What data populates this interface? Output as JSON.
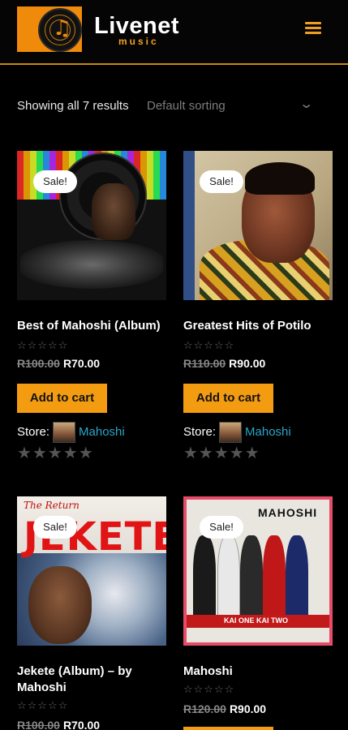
{
  "header": {
    "brand_name": "Livenet",
    "brand_sub": "music",
    "logo_icon": "music-note-disc-icon",
    "menu_icon": "hamburger-menu-icon",
    "accent_color": "#f39c12",
    "divider_color": "#c98a0f"
  },
  "toolbar": {
    "result_count": "Showing all 7 results",
    "sorting": "Default sorting",
    "sort_icon": "chevron-down-icon"
  },
  "products": [
    {
      "sale_badge": "Sale!",
      "title": "Best of Mahoshi (Album)",
      "price_old": "R100.00",
      "price_new": "R70.00",
      "button": "Add to cart",
      "store_label": "Store:",
      "store_name": "Mahoshi",
      "rating": 0
    },
    {
      "sale_badge": "Sale!",
      "title": "Greatest Hits of Potilo",
      "price_old": "R110.00",
      "price_new": "R90.00",
      "button": "Add to cart",
      "store_label": "Store:",
      "store_name": "Mahoshi",
      "rating": 0
    },
    {
      "sale_badge": "Sale!",
      "title": "Jekete (Album) – by Mahoshi",
      "price_old": "R100.00",
      "price_new": "R70.00",
      "cover_text": "JEKETE",
      "cover_subtext": "The Return",
      "rating": 0
    },
    {
      "sale_badge": "Sale!",
      "title": "Mahoshi",
      "price_old": "R120.00",
      "price_new": "R90.00",
      "cover_text": "MAHOSHI",
      "cover_subtext": "KAI ONE KAI TWO",
      "rating": 0
    }
  ]
}
